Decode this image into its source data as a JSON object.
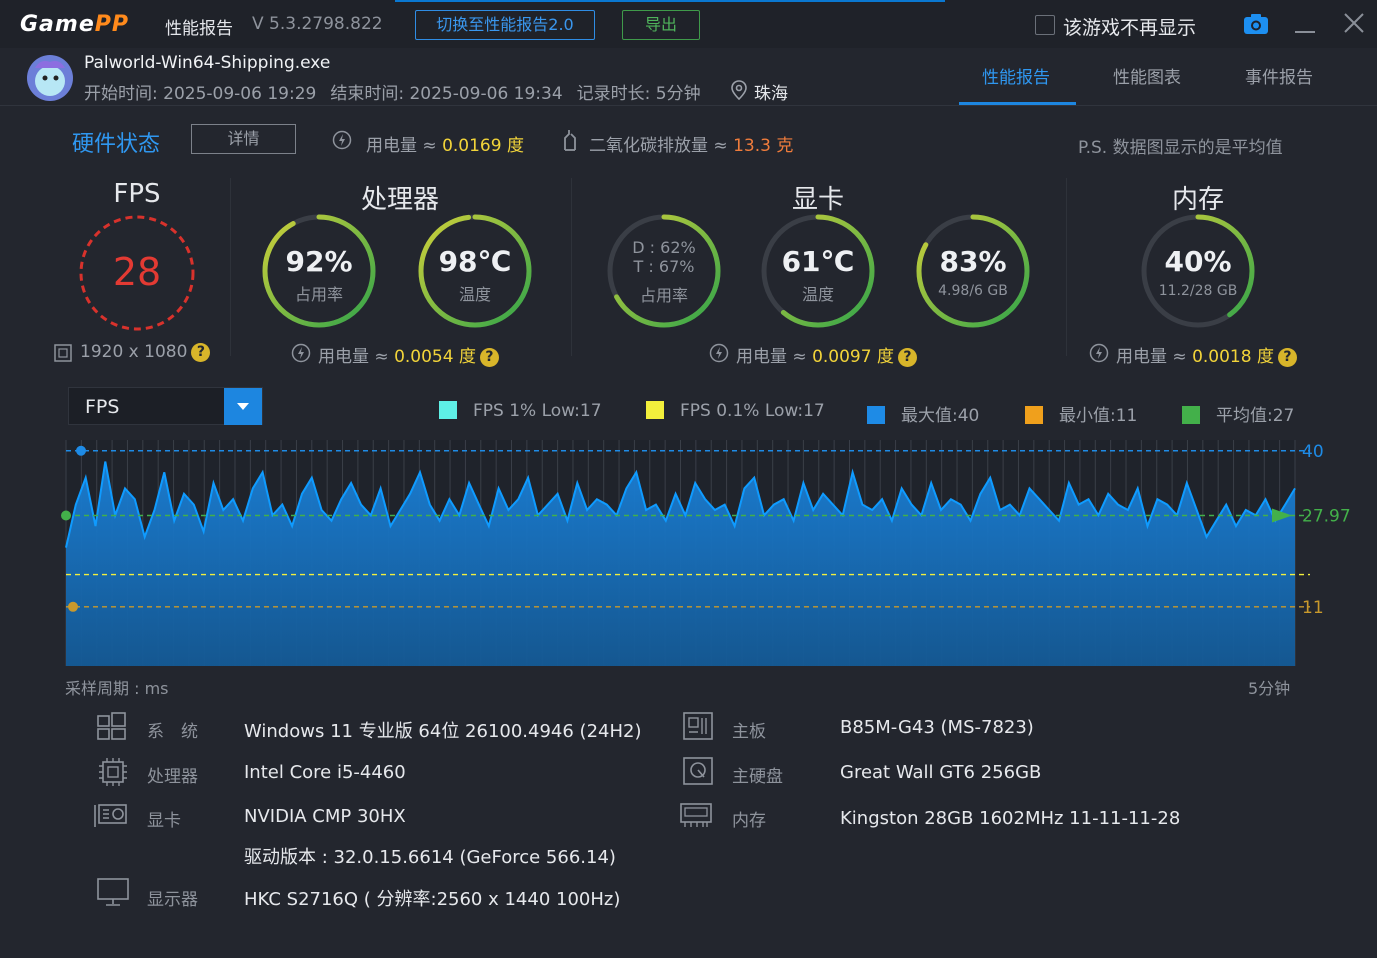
{
  "titlebar": {
    "app_name": "GamePP",
    "title": "性能报告",
    "version": "V 5.3.2798.822",
    "switch_button": "切换至性能报告2.0",
    "export_button": "导出",
    "no_show_label": "该游戏不再显示"
  },
  "session": {
    "exe": "Palworld-Win64-Shipping.exe",
    "start": "开始时间: 2025-09-06 19:29",
    "end": "结束时间: 2025-09-06 19:34",
    "duration": "记录时长: 5分钟",
    "location": "珠海"
  },
  "tabs": [
    "性能报告",
    "性能图表",
    "事件报告"
  ],
  "hardware": {
    "title": "硬件状态",
    "detail_button": "详情",
    "power_label": "用电量 ≈",
    "power_value": "0.0169 度",
    "co2_label": "二氧化碳排放量 ≈",
    "co2_value": "13.3 克",
    "note": "P.S. 数据图显示的是平均值"
  },
  "fps_panel": {
    "title": "FPS",
    "value": "28",
    "resolution": "1920 x 1080"
  },
  "cpu_panel": {
    "title": "处理器",
    "usage": "92%",
    "usage_label": "占用率",
    "usage_level": 0.92,
    "temp": "98℃",
    "temp_label": "温度",
    "temp_level": 0.98,
    "power_label": "用电量 ≈",
    "power_value": "0.0054 度"
  },
  "gpu_panel": {
    "title": "显卡",
    "d_usage": "D : 62%",
    "t_usage": "T : 67%",
    "usage_label": "占用率",
    "usage_level": 0.67,
    "temp": "61℃",
    "temp_label": "温度",
    "temp_level": 0.61,
    "vram": "83%",
    "vram_detail": "4.98/6 GB",
    "vram_level": 0.83,
    "power_label": "用电量 ≈",
    "power_value": "0.0097 度"
  },
  "mem_panel": {
    "title": "内存",
    "usage": "40%",
    "detail": "11.2/28 GB",
    "usage_level": 0.4,
    "power_label": "用电量 ≈",
    "power_value": "0.0018 度"
  },
  "chart_selector": {
    "value": "FPS"
  },
  "legend": [
    {
      "label": "FPS 1% Low:17",
      "color": "#5ef0e6"
    },
    {
      "label": "FPS 0.1% Low:17",
      "color": "#f3ef3c"
    },
    {
      "label": "最大值:40",
      "color": "#1e8be6"
    },
    {
      "label": "最小值:11",
      "color": "#f0a01c"
    },
    {
      "label": "平均值:27",
      "color": "#43b04a"
    }
  ],
  "chart_data": {
    "type": "area",
    "series": [
      {
        "values": [
          22,
          30,
          35,
          26,
          38,
          28,
          33,
          31,
          24,
          29,
          36,
          27,
          32,
          30,
          25,
          34,
          29,
          31,
          27,
          33,
          36,
          28,
          30,
          26,
          32,
          35,
          29,
          27,
          31,
          34,
          30,
          28,
          33,
          26,
          29,
          32,
          36,
          30,
          27,
          31,
          28,
          34,
          30,
          26,
          33,
          29,
          31,
          35,
          28,
          30,
          32,
          27,
          34,
          29,
          31,
          30,
          28,
          33,
          36,
          29,
          30,
          27,
          32,
          28,
          34,
          31,
          29,
          30,
          26,
          33,
          35,
          28,
          30,
          31,
          27,
          34,
          29,
          32,
          30,
          28,
          36,
          30,
          29,
          31,
          27,
          33,
          30,
          28,
          34,
          29,
          31,
          30,
          27,
          32,
          35,
          29,
          30,
          28,
          33,
          31,
          29,
          27,
          34,
          30,
          31,
          28,
          32,
          30,
          29,
          33,
          26,
          31,
          30,
          28,
          34,
          29,
          24,
          27,
          30,
          26,
          29,
          28,
          31,
          27,
          30,
          33
        ]
      }
    ],
    "ylim": [
      0,
      42
    ],
    "reference_lines": {
      "max": 40,
      "min": 11,
      "avg": 27.97,
      "low1": 17,
      "low01": 17
    },
    "y_labels": [
      "40",
      "27.97",
      "11"
    ],
    "xlabel_left": "采样周期 : ms",
    "xlabel_right": "5分钟"
  },
  "system_info": {
    "os_label": "系　统",
    "os": "Windows 11 专业版 64位 26100.4946 (24H2)",
    "cpu_label": "处理器",
    "cpu": "Intel Core i5-4460",
    "gpu_label": "显卡",
    "gpu": "NVIDIA CMP 30HX",
    "driver": "驱动版本 : 32.0.15.6614 (GeForce 566.14)",
    "monitor_label": "显示器",
    "monitor": "HKC S2716Q ( 分辨率:2560 x 1440 100Hz)",
    "board_label": "主板",
    "board": "B85M-G43 (MS-7823)",
    "disk_label": "主硬盘",
    "disk": "Great Wall GT6 256GB",
    "ram_label": "内存",
    "ram": "Kingston 28GB 1602MHz 11-11-11-28"
  }
}
